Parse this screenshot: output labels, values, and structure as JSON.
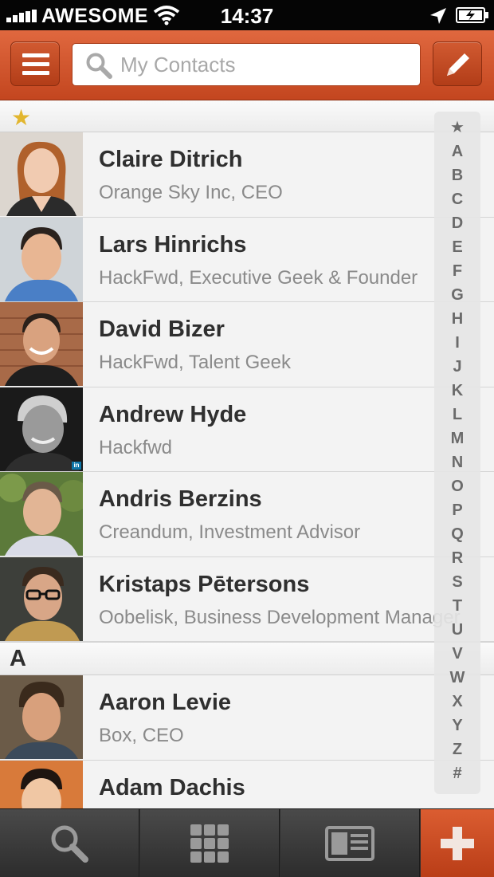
{
  "status_bar": {
    "carrier": "AWESOME",
    "time": "14:37"
  },
  "nav": {
    "menu_icon": "hamburger-menu-icon",
    "search_placeholder": "My Contacts",
    "compose_icon": "pencil-icon"
  },
  "sections": [
    {
      "type": "favorites",
      "icon": "star-icon",
      "contacts": [
        {
          "name": "Claire Ditrich",
          "company": "Orange Sky Inc, CEO"
        },
        {
          "name": "Lars Hinrichs",
          "company": "HackFwd, Executive Geek & Founder"
        },
        {
          "name": "David Bizer",
          "company": "HackFwd, Talent Geek"
        },
        {
          "name": "Andrew Hyde",
          "company": "Hackfwd"
        },
        {
          "name": "Andris Berzins",
          "company": "Creandum, Investment Advisor"
        },
        {
          "name": "Kristaps Pētersons",
          "company": "Oobelisk, Business Development Manager"
        }
      ]
    },
    {
      "type": "letter",
      "letter": "A",
      "contacts": [
        {
          "name": "Aaron Levie",
          "company": "Box, CEO"
        },
        {
          "name": "Adam Dachis",
          "company": ""
        }
      ]
    }
  ],
  "index": [
    "★",
    "A",
    "B",
    "C",
    "D",
    "E",
    "F",
    "G",
    "H",
    "I",
    "J",
    "K",
    "L",
    "M",
    "N",
    "O",
    "P",
    "Q",
    "R",
    "S",
    "T",
    "U",
    "V",
    "W",
    "X",
    "Y",
    "Z",
    "#"
  ],
  "tabs": [
    {
      "icon": "search-icon"
    },
    {
      "icon": "keypad-icon"
    },
    {
      "icon": "card-icon"
    },
    {
      "icon": "plus-icon"
    }
  ],
  "colors": {
    "accent": "#c9491f",
    "star": "#e2b62f"
  }
}
